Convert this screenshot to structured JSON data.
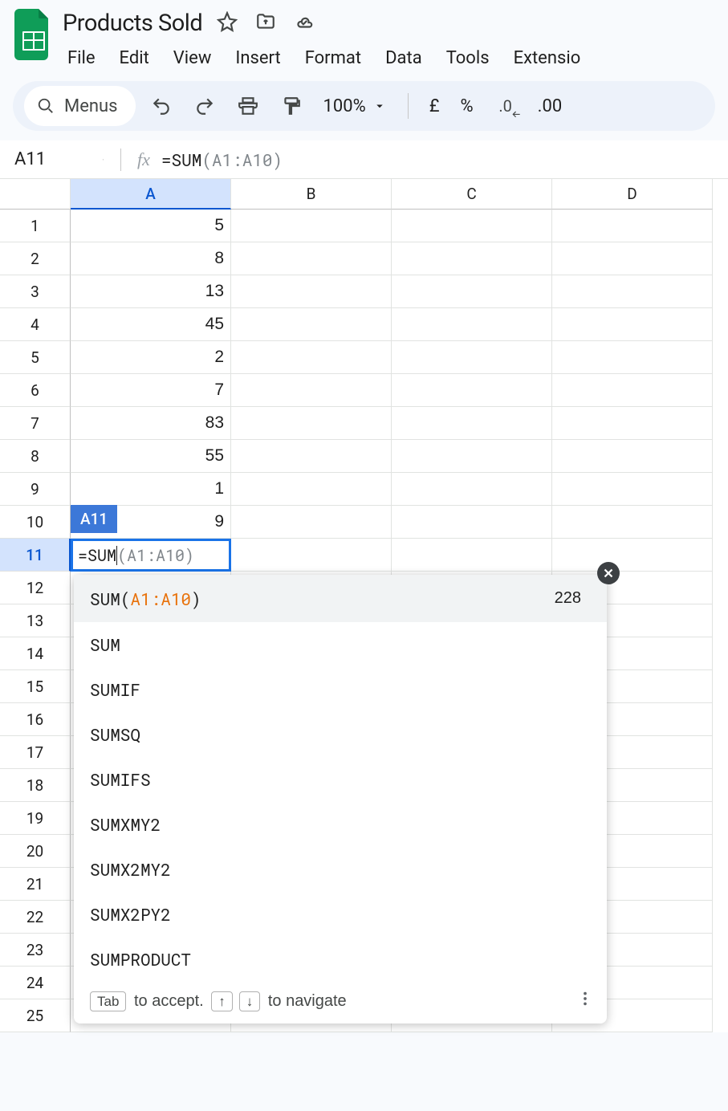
{
  "doc": {
    "title": "Products Sold"
  },
  "menus": {
    "search_label": "Menus",
    "items": [
      "File",
      "Edit",
      "View",
      "Insert",
      "Format",
      "Data",
      "Tools",
      "Extensio"
    ]
  },
  "toolbar": {
    "zoom": "100%",
    "currency": "£",
    "percent": "%",
    "dec_dec": ".0",
    "inc_dec": ".00"
  },
  "namebox": {
    "ref": "A11"
  },
  "formula_bar": {
    "typed": "=SUM",
    "ghost": "(A1:A10)"
  },
  "columns": [
    "A",
    "B",
    "C",
    "D"
  ],
  "row_numbers": [
    1,
    2,
    3,
    4,
    5,
    6,
    7,
    8,
    9,
    10,
    11,
    12,
    13,
    14,
    15,
    16,
    17,
    18,
    19,
    20,
    21,
    22,
    23,
    24,
    25
  ],
  "cells_a": [
    "5",
    "8",
    "13",
    "45",
    "2",
    "7",
    "83",
    "55",
    "1",
    "9"
  ],
  "active_badge": "A11",
  "editing": {
    "typed": "=SUM",
    "ghost": "(A1:A10)"
  },
  "autocomplete": {
    "first": {
      "prefix": "SUM(",
      "range": "A1:A10",
      "suffix": ")",
      "result": "228"
    },
    "rest": [
      "SUM",
      "SUMIF",
      "SUMSQ",
      "SUMIFS",
      "SUMXMY2",
      "SUMX2MY2",
      "SUMX2PY2",
      "SUMPRODUCT"
    ],
    "footer": {
      "tab_key": "Tab",
      "accept": "to accept.",
      "up_key": "↑",
      "down_key": "↓",
      "navigate": "to navigate"
    }
  }
}
